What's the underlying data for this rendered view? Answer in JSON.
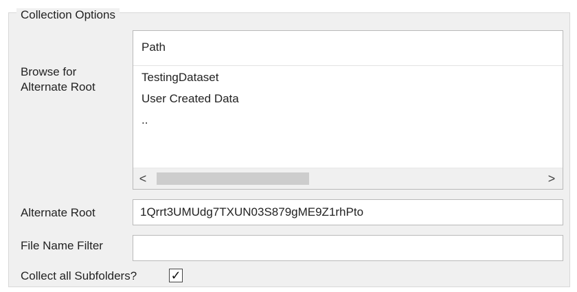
{
  "group": {
    "title": "Collection Options"
  },
  "browse": {
    "label_line1": "Browse for",
    "label_line2": "Alternate Root",
    "column_header": "Path",
    "items": [
      "TestingDataset",
      "User Created Data",
      ".."
    ],
    "scroll_left_icon": "chevron-left-icon",
    "scroll_right_icon": "chevron-right-icon",
    "scroll_left_glyph": "<",
    "scroll_right_glyph": ">"
  },
  "alternate_root": {
    "label": "Alternate Root",
    "value": "1Qrrt3UMUdg7TXUN03S879gME9Z1rhPto"
  },
  "file_name_filter": {
    "label": "File Name Filter",
    "value": ""
  },
  "collect_subfolders": {
    "label": "Collect all Subfolders?",
    "checked": true,
    "check_glyph": "✓"
  }
}
